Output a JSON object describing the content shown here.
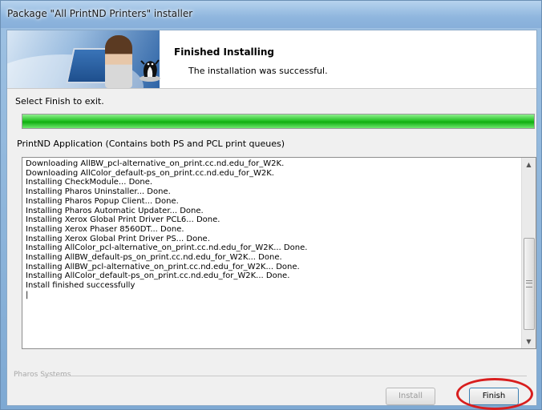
{
  "window": {
    "title": "Package \"All PrintND Printers\" installer"
  },
  "banner": {
    "title": "Finished Installing",
    "subtitle": "The installation was successful."
  },
  "instructions": "Select Finish to exit.",
  "progress": {
    "percent": 100
  },
  "package_label": "PrintND Application (Contains both PS and PCL print queues)",
  "log": {
    "lines": [
      "Downloading AllBW_pcl-alternative_on_print.cc.nd.edu_for_W2K.",
      "Downloading AllColor_default-ps_on_print.cc.nd.edu_for_W2K.",
      "Installing CheckModule... Done.",
      "Installing Pharos Uninstaller... Done.",
      "Installing Pharos Popup Client... Done.",
      "Installing Pharos Automatic Updater... Done.",
      "Installing Xerox Global Print Driver PCL6... Done.",
      "Installing Xerox Phaser 8560DT... Done.",
      "Installing Xerox Global Print Driver PS... Done.",
      "Installing AllColor_pcl-alternative_on_print.cc.nd.edu_for_W2K... Done.",
      "Installing AllBW_default-ps_on_print.cc.nd.edu_for_W2K... Done.",
      "Installing AllBW_pcl-alternative_on_print.cc.nd.edu_for_W2K... Done.",
      "Installing AllColor_default-ps_on_print.cc.nd.edu_for_W2K... Done.",
      "Install finished successfully",
      "|"
    ]
  },
  "footer": {
    "group_label": "Pharos Systems"
  },
  "buttons": {
    "install": "Install",
    "finish": "Finish"
  },
  "icons": {
    "scroll_up": "scroll-up-arrow-icon",
    "scroll_down": "scroll-down-arrow-icon",
    "mascot": "pharos-mascot-icon"
  },
  "colors": {
    "progress_fill": "#1fbd1f",
    "highlight": "#d81e1e",
    "title_bar": "#8fb6de"
  }
}
